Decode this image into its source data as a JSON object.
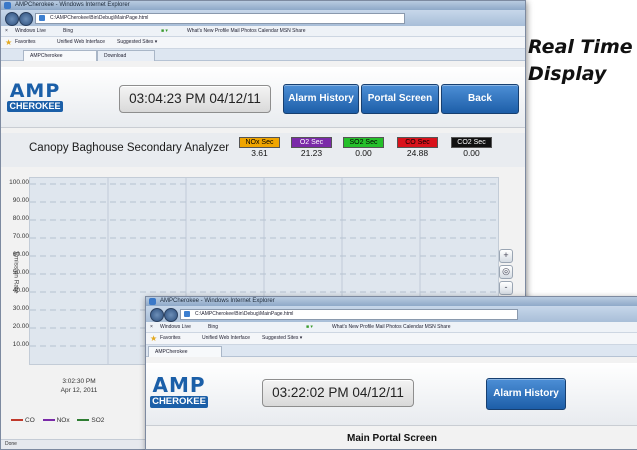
{
  "caption": {
    "line1": "Real Time",
    "line2": "Display"
  },
  "window1": {
    "title": "AMPCherokee - Windows Internet Explorer",
    "address": "C:\\AMPCherokee\\Bin\\Debug\\MainPage.html",
    "toolbar": {
      "search_label": "Windows Live",
      "search_engine": "Bing",
      "menu": "What's New   Profile   Mail   Photos   Calendar   MSN   Share"
    },
    "favorites": {
      "label": "Favorites",
      "link1": "Unified Web Interface",
      "link2": "Suggested Sites ▾"
    },
    "tabs": [
      {
        "label": "AMPCherokee"
      },
      {
        "label": "Download"
      }
    ],
    "app": {
      "logo_amp": "AMP",
      "logo_cherokee": "CHEROKEE",
      "clock": "03:04:23 PM 04/12/11",
      "buttons": {
        "alarm_history": "Alarm History",
        "portal_screen": "Portal Screen",
        "back": "Back"
      },
      "analyzer_title": "Canopy Baghouse Secondary Analyzer",
      "gases": [
        {
          "label": "NOx Sec",
          "value": "3.61",
          "color": "#f0a500",
          "text_color": "#000000"
        },
        {
          "label": "O2 Sec",
          "value": "21.23",
          "color": "#7a2aa8",
          "text_color": "#ffffff"
        },
        {
          "label": "SO2 Sec",
          "value": "0.00",
          "color": "#25c02a",
          "text_color": "#000000"
        },
        {
          "label": "CO Sec",
          "value": "24.88",
          "color": "#d9121b",
          "text_color": "#000000"
        },
        {
          "label": "CO2 Sec",
          "value": "0.00",
          "color": "#111111",
          "text_color": "#ffffff"
        }
      ],
      "zoom": {
        "in": "+",
        "reset": "◎",
        "out": "-"
      },
      "status": "Done"
    },
    "chart_data": {
      "type": "line",
      "ylabel": "Emission Rate",
      "ylim": [
        0,
        100
      ],
      "y_ticks": [
        "100.00",
        "90.00",
        "80.00",
        "70.00",
        "60.00",
        "50.00",
        "40.00",
        "30.00",
        "20.00",
        "10.00"
      ],
      "x_time_line1": "3:02:30 PM",
      "x_time_line2": "Apr 12, 2011",
      "grid": true,
      "series": [
        {
          "name": "CO",
          "color": "#c0392b"
        },
        {
          "name": "NOx",
          "color": "#7a2aa8"
        },
        {
          "name": "SO2",
          "color": "#2e7d32"
        }
      ]
    }
  },
  "window2": {
    "title": "AMPCherokee - Windows Internet Explorer",
    "address": "C:\\AMPCherokee\\Bin\\Debug\\MainPage.html",
    "toolbar": {
      "search_label": "Windows Live",
      "search_engine": "Bing",
      "menu": "What's New   Profile   Mail   Photos   Calendar   MSN   Share"
    },
    "favorites": {
      "label": "Favorites",
      "link1": "Unified Web Interface",
      "link2": "Suggested Sites ▾"
    },
    "tabs": [
      {
        "label": "AMPCherokee"
      }
    ],
    "app": {
      "logo_amp": "AMP",
      "logo_cherokee": "CHEROKEE",
      "clock": "03:22:02 PM 04/12/11",
      "buttons": {
        "alarm_history": "Alarm History"
      },
      "portal_title": "Main Portal Screen"
    }
  }
}
